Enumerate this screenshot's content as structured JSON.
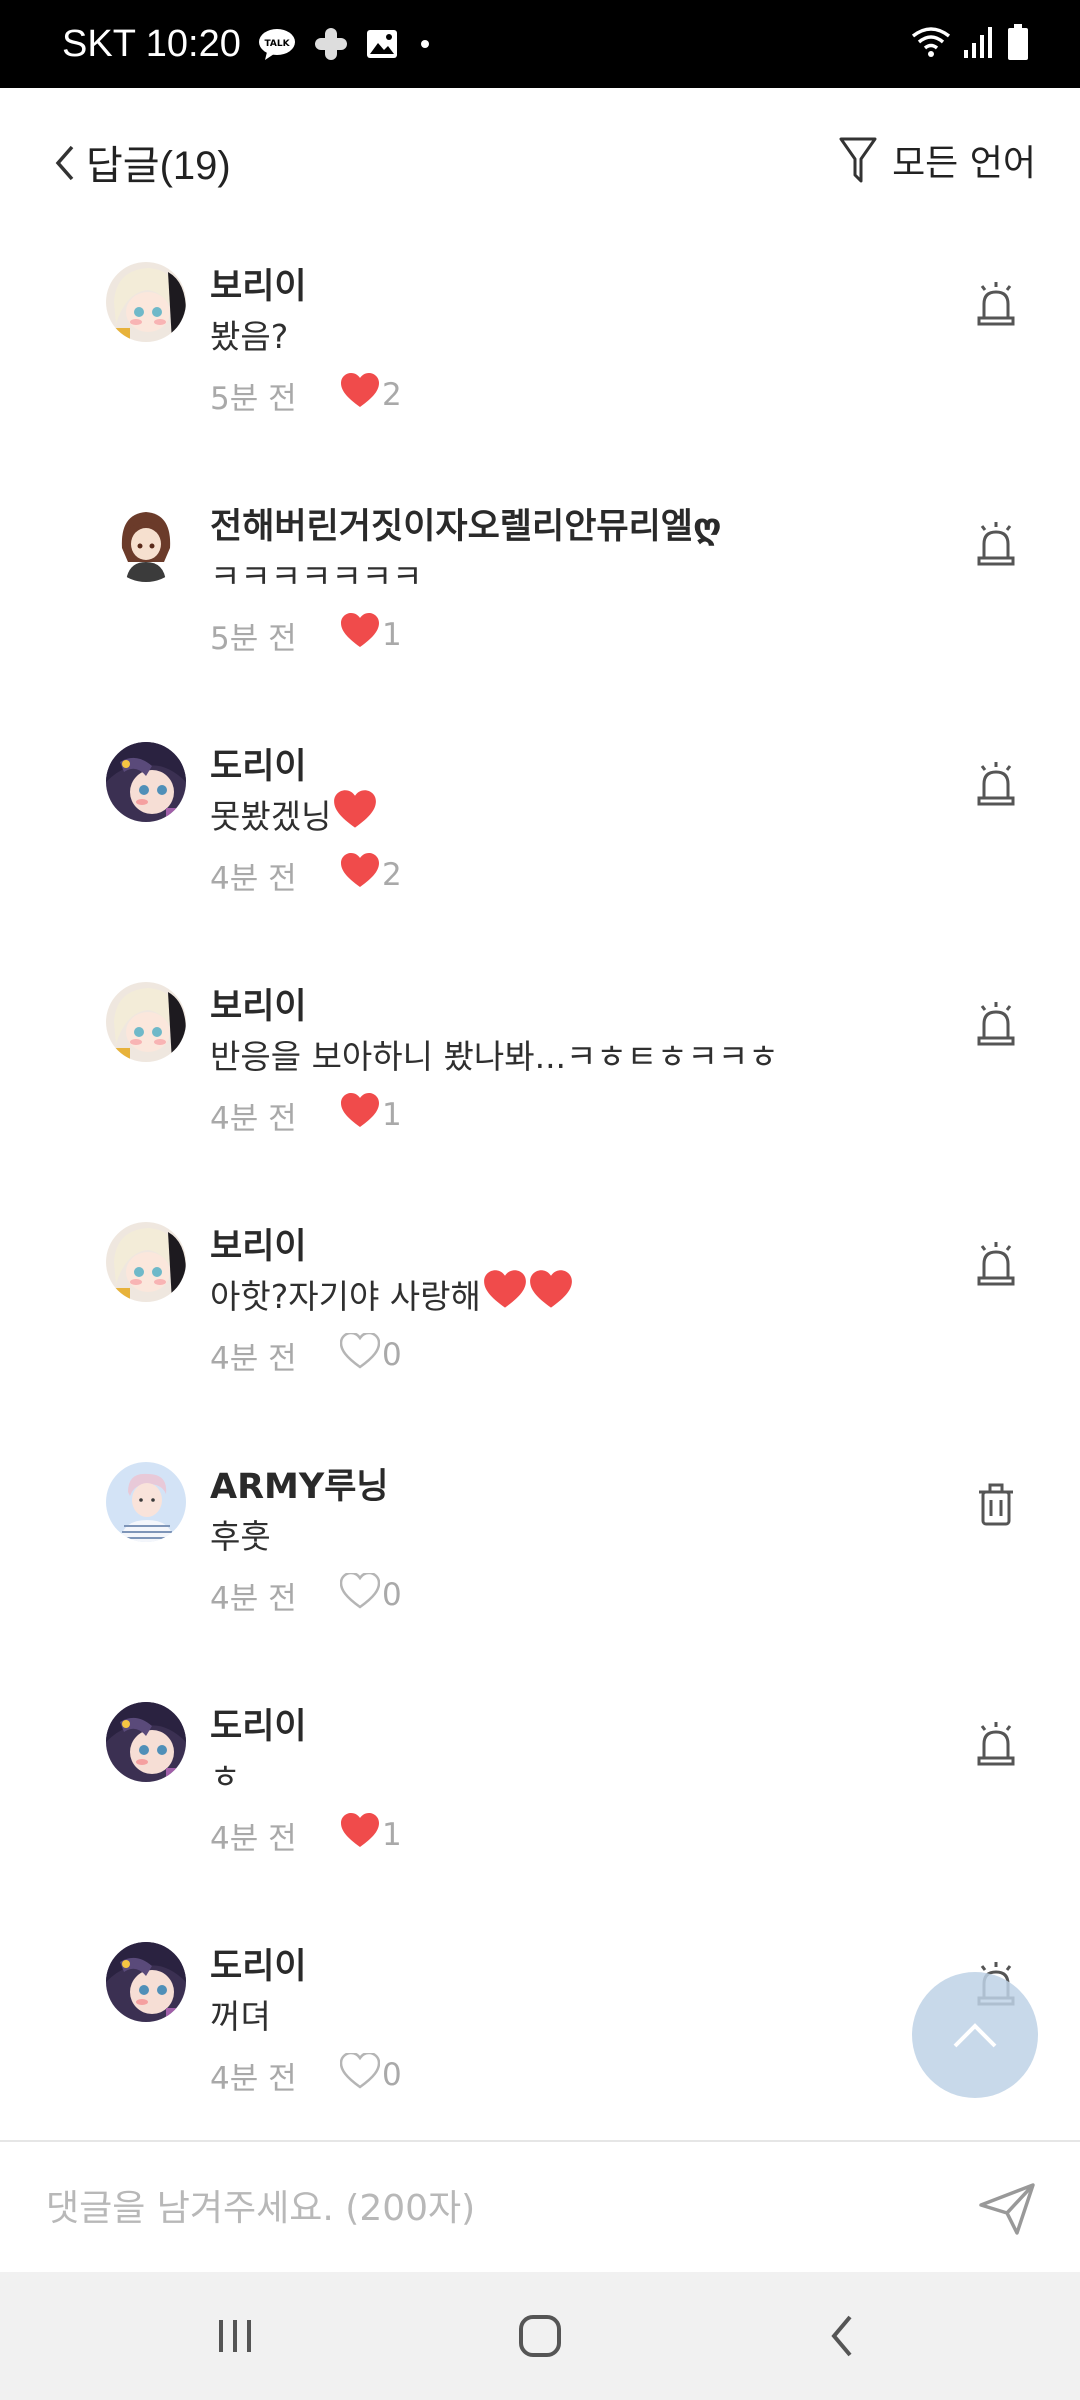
{
  "status_bar": {
    "carrier_time": "SKT 10:20",
    "icons": [
      "talk-icon",
      "plus-app-icon",
      "gallery-icon",
      "dot-icon",
      "wifi-icon",
      "signal-icon",
      "battery-icon"
    ]
  },
  "header": {
    "title": "답글(19)",
    "language_filter": "모든 언어"
  },
  "comments": [
    {
      "name": "보리이",
      "text": "봤음?",
      "time": "5분 전",
      "likes": "2",
      "liked": true,
      "action": "report",
      "avatar": "blonde"
    },
    {
      "name": "전해버린거짓이자오렐리안뮤리엘ღ",
      "text": "ㅋㅋㅋㅋㅋㅋㅋ",
      "time": "5분 전",
      "likes": "1",
      "liked": true,
      "action": "report",
      "avatar": "brown"
    },
    {
      "name": "도리이",
      "text": "못봤겠닝",
      "text_heart": true,
      "time": "4분 전",
      "likes": "2",
      "liked": true,
      "action": "report",
      "avatar": "dark"
    },
    {
      "name": "보리이",
      "text": "반응을 보아하니 봤나봐...ㅋㅎㅌㅎㅋㅋㅎ",
      "time": "4분 전",
      "likes": "1",
      "liked": true,
      "action": "report",
      "avatar": "blonde"
    },
    {
      "name": "보리이",
      "text": "아핫?자기야 사랑해",
      "text_hearts": 2,
      "time": "4분 전",
      "likes": "0",
      "liked": false,
      "action": "report",
      "avatar": "blonde"
    },
    {
      "name": "ARMY루닝",
      "text": "후훗",
      "time": "4분 전",
      "likes": "0",
      "liked": false,
      "action": "delete",
      "avatar": "boy"
    },
    {
      "name": "도리이",
      "text": "ㅎ",
      "time": "4분 전",
      "likes": "1",
      "liked": true,
      "action": "report",
      "avatar": "dark"
    },
    {
      "name": "도리이",
      "text": "꺼뎌",
      "time": "4분 전",
      "likes": "0",
      "liked": false,
      "action": "report",
      "avatar": "dark"
    }
  ],
  "input": {
    "placeholder": "댓글을 남겨주세요. (200자)"
  },
  "colors": {
    "heart": "#f04b4b",
    "meta": "#a9a9a9",
    "scroll_top": "#c8d8e8"
  }
}
